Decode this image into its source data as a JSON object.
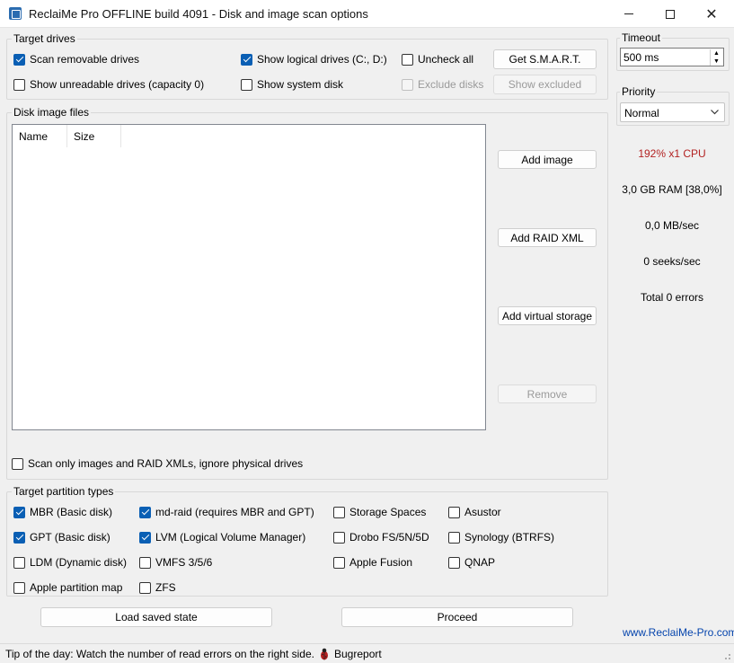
{
  "window": {
    "title": "ReclaiMe Pro OFFLINE build 4091 - Disk and image scan options",
    "minimize_glyph": "",
    "maximize_glyph": "",
    "close_glyph": "✕"
  },
  "target_drives": {
    "legend": "Target drives",
    "scan_removable": {
      "label": "Scan removable drives",
      "checked": true
    },
    "show_unreadable": {
      "label": "Show unreadable drives (capacity 0)",
      "checked": false
    },
    "show_logical": {
      "label": "Show logical drives (C:, D:)",
      "checked": true
    },
    "show_system": {
      "label": "Show system disk",
      "checked": false
    },
    "uncheck_all": {
      "label": "Uncheck all",
      "checked": false
    },
    "exclude_disks": {
      "label": "Exclude disks",
      "checked": false,
      "disabled": true
    },
    "get_smart": "Get S.M.A.R.T.",
    "show_excluded": "Show excluded"
  },
  "disk_images": {
    "legend": "Disk image files",
    "columns": [
      "Name",
      "Size"
    ],
    "rows": [],
    "add_image": "Add image",
    "add_raid_xml": "Add RAID XML",
    "add_virtual_storage": "Add virtual storage",
    "remove": "Remove",
    "scan_only_images": {
      "label": "Scan only images and RAID XMLs, ignore physical drives",
      "checked": false
    }
  },
  "partition_types": {
    "legend": "Target partition types",
    "items": [
      {
        "label": "MBR (Basic disk)",
        "checked": true
      },
      {
        "label": "GPT (Basic disk)",
        "checked": true
      },
      {
        "label": "LDM (Dynamic disk)",
        "checked": false
      },
      {
        "label": "Apple partition map",
        "checked": false
      },
      {
        "label": "md-raid (requires MBR and GPT)",
        "checked": true
      },
      {
        "label": "LVM (Logical Volume Manager)",
        "checked": true
      },
      {
        "label": "VMFS 3/5/6",
        "checked": false
      },
      {
        "label": "ZFS",
        "checked": false
      },
      {
        "label": "Storage Spaces",
        "checked": false
      },
      {
        "label": "Drobo FS/5N/5D",
        "checked": false
      },
      {
        "label": "Apple Fusion",
        "checked": false
      },
      {
        "label": "Asustor",
        "checked": false
      },
      {
        "label": "Synology (BTRFS)",
        "checked": false
      },
      {
        "label": "QNAP",
        "checked": false
      }
    ]
  },
  "actions": {
    "load_saved_state": "Load saved state",
    "proceed": "Proceed"
  },
  "side_panel": {
    "timeout_label": "Timeout",
    "timeout_value": "500 ms",
    "priority_label": "Priority",
    "priority_value": "Normal",
    "cpu": "192% x1 CPU",
    "cpu_color": "#b22222",
    "ram": "3,0 GB RAM [38,0%]",
    "speed": "0,0 MB/sec",
    "seeks": "0 seeks/sec",
    "errors": "Total 0 errors",
    "website": "www.ReclaiMe-Pro.com"
  },
  "status": {
    "tip": "Tip of the day: Watch the number of read errors on the right side.",
    "bugreport": "Bugreport"
  }
}
